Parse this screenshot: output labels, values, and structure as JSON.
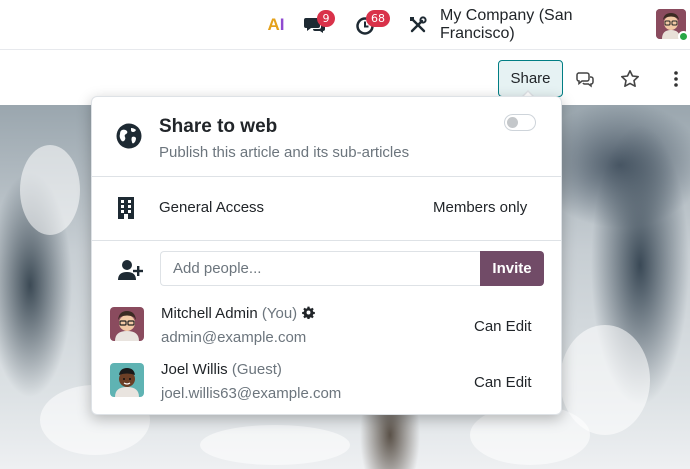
{
  "topbar": {
    "ai_letters": [
      "A",
      "I"
    ],
    "messages_badge": "9",
    "activity_badge": "68",
    "company": "My Company (San Francisco)"
  },
  "actionbar": {
    "share_label": "Share"
  },
  "popover": {
    "share_web": {
      "title": "Share to web",
      "subtitle": "Publish this article and its sub-articles",
      "toggle_on": false
    },
    "general_access": {
      "label": "General Access",
      "value": "Members only"
    },
    "invite": {
      "placeholder": "Add people...",
      "button_label": "Invite"
    },
    "members": [
      {
        "name": "Mitchell Admin",
        "tag": "(You)",
        "email": "admin@example.com",
        "permission": "Can Edit"
      },
      {
        "name": "Joel Willis",
        "tag": "(Guest)",
        "email": "joel.willis63@example.com",
        "permission": "Can Edit"
      }
    ]
  },
  "colors": {
    "primary": "#714b67",
    "accent": "#017e84",
    "badge": "#d9324a",
    "online": "#28a745"
  }
}
